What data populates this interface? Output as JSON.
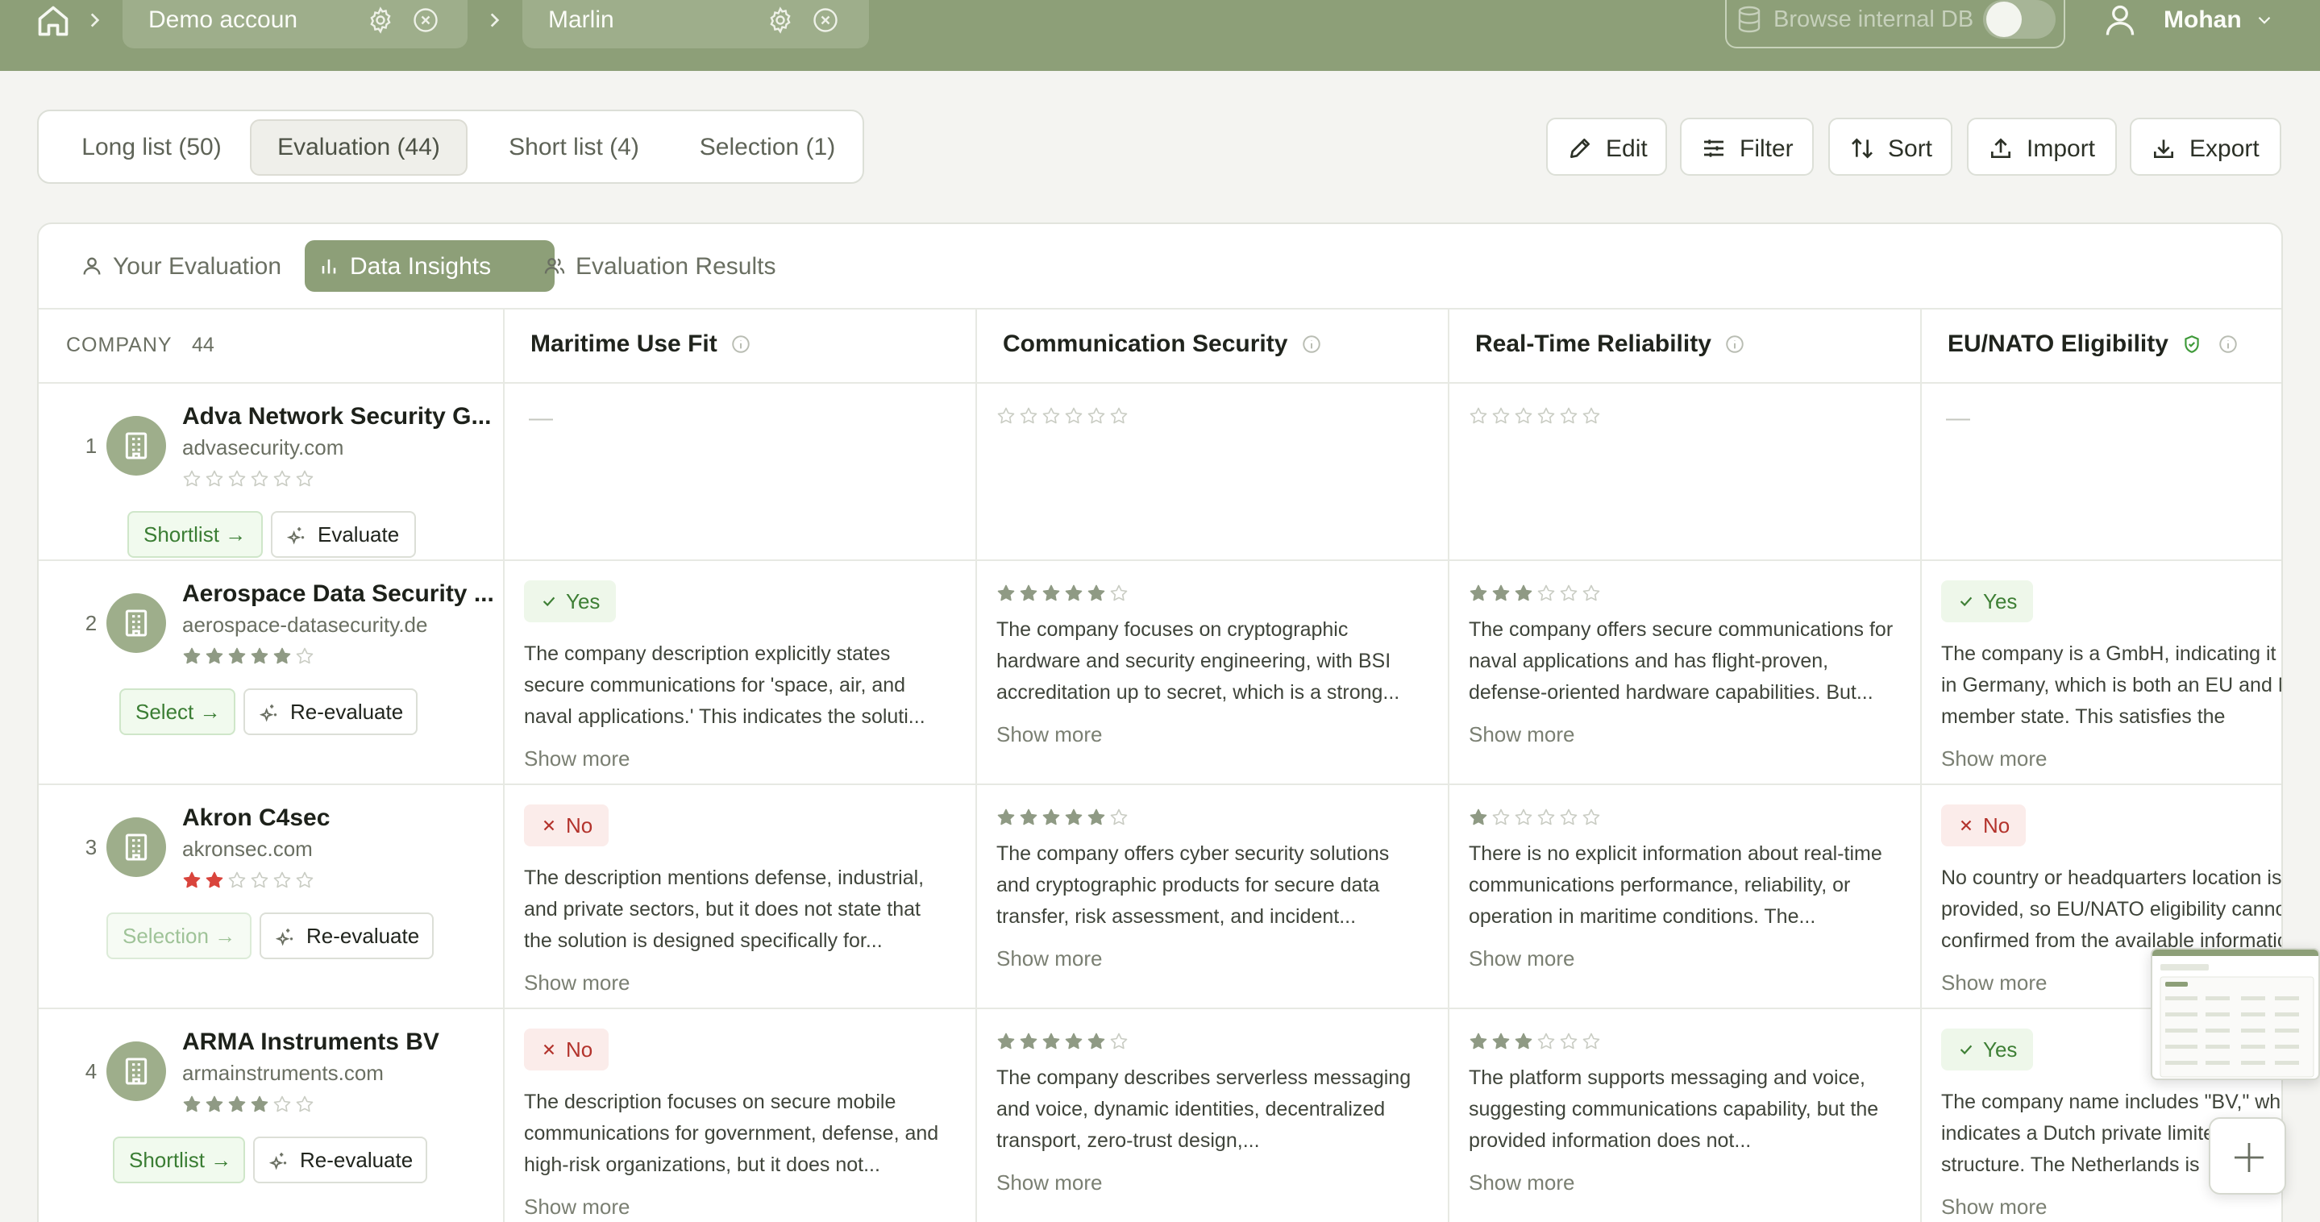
{
  "topbar": {
    "breadcrumbs": [
      {
        "label": "Demo accoun"
      },
      {
        "label": "Marlin"
      }
    ],
    "browse_db": {
      "label": "Browse internal DB",
      "enabled": false
    },
    "user": {
      "name": "Mohan"
    }
  },
  "list_tabs": [
    {
      "label": "Long list (50)",
      "active": false
    },
    {
      "label": "Evaluation (44)",
      "active": true
    },
    {
      "label": "Short list (4)",
      "active": false
    },
    {
      "label": "Selection (1)",
      "active": false
    }
  ],
  "toolbar": {
    "edit": "Edit",
    "filter": "Filter",
    "sort": "Sort",
    "import": "Import",
    "export": "Export"
  },
  "view_tabs": [
    {
      "label": "Your Evaluation",
      "icon": "user-icon",
      "active": false
    },
    {
      "label": "Data Insights",
      "icon": "bar-chart-icon",
      "active": true
    },
    {
      "label": "Evaluation Results",
      "icon": "users-icon",
      "active": false
    }
  ],
  "table": {
    "company_header": "COMPANY",
    "company_count": "44",
    "columns": [
      {
        "title": "Maritime Use Fit",
        "icon": "info-icon"
      },
      {
        "title": "Communication Security",
        "icon": "info-icon"
      },
      {
        "title": "Real-Time Reliability",
        "icon": "info-icon"
      },
      {
        "title": "EU/NATO Eligibility",
        "icon": "shield-check-icon info-icon"
      }
    ],
    "show_more": "Show more",
    "empty": "—",
    "rows": [
      {
        "rank": "1",
        "name": "Adva Network Security G...",
        "domain": "advasecurity.com",
        "rating": 0,
        "status": "Shortlist →",
        "action": "Evaluate",
        "cells": [
          {
            "type": "empty",
            "text": "—"
          },
          {
            "type": "stars",
            "rating": 0
          },
          {
            "type": "stars",
            "rating": 0
          },
          {
            "type": "empty",
            "text": "—"
          }
        ]
      },
      {
        "rank": "2",
        "name": "Aerospace Data Security ...",
        "domain": "aerospace-datasecurity.de",
        "rating": 5,
        "status": "Select →",
        "action": "Re-evaluate",
        "cells": [
          {
            "type": "badge",
            "value": "Yes",
            "text": "The company description explicitly states secure communications for 'space, air, and naval applications.' This indicates the soluti..."
          },
          {
            "type": "stars",
            "rating": 5,
            "text": "The company focuses on cryptographic hardware and security engineering, with BSI accreditation up to secret, which is a strong..."
          },
          {
            "type": "stars",
            "rating": 3,
            "text": "The company offers secure communications for naval applications and has flight-proven, defense-oriented hardware capabilities. But..."
          },
          {
            "type": "badge",
            "value": "Yes",
            "text": "The company is a GmbH, indicating it is based in Germany, which is both an EU and NATO member state. This satisfies the"
          }
        ]
      },
      {
        "rank": "3",
        "name": "Akron C4sec",
        "domain": "akronsec.com",
        "rating": 2,
        "status": "Selection →",
        "action": "Re-evaluate",
        "cells": [
          {
            "type": "badge",
            "value": "No",
            "text": "The description mentions defense, industrial, and private sectors, but it does not state that the solution is designed specifically for..."
          },
          {
            "type": "stars",
            "rating": 5,
            "text": "The company offers cyber security solutions and cryptographic products for secure data transfer, risk assessment, and incident..."
          },
          {
            "type": "stars",
            "rating": 1,
            "text": "There is no explicit information about real-time communications performance, reliability, or operation in maritime conditions. The..."
          },
          {
            "type": "badge",
            "value": "No",
            "text": "No country or headquarters location is provided, so EU/NATO eligibility cannot be confirmed from the available information."
          }
        ]
      },
      {
        "rank": "4",
        "name": "ARMA Instruments BV",
        "domain": "armainstruments.com",
        "rating": 4,
        "status": "Shortlist →",
        "action": "Re-evaluate",
        "cells": [
          {
            "type": "badge",
            "value": "No",
            "text": "The description focuses on secure mobile communications for government, defense, and high-risk organizations, but it does not..."
          },
          {
            "type": "stars",
            "rating": 5,
            "text": "The company describes serverless messaging and voice, dynamic identities, decentralized transport, zero-trust design,..."
          },
          {
            "type": "stars",
            "rating": 3,
            "text": "The platform supports messaging and voice, suggesting communications capability, but the provided information does not..."
          },
          {
            "type": "badge",
            "value": "Yes",
            "text": "The company name includes \"BV,\" which indicates a Dutch private limited company structure. The Netherlands is"
          }
        ]
      }
    ]
  },
  "colors": {
    "accent": "#8d9f78",
    "star_filled": "#8f9a84",
    "star_red": "#d9443c",
    "star_empty": "#c9ccc3",
    "yes": "#3e7f35",
    "no": "#b3332c"
  }
}
